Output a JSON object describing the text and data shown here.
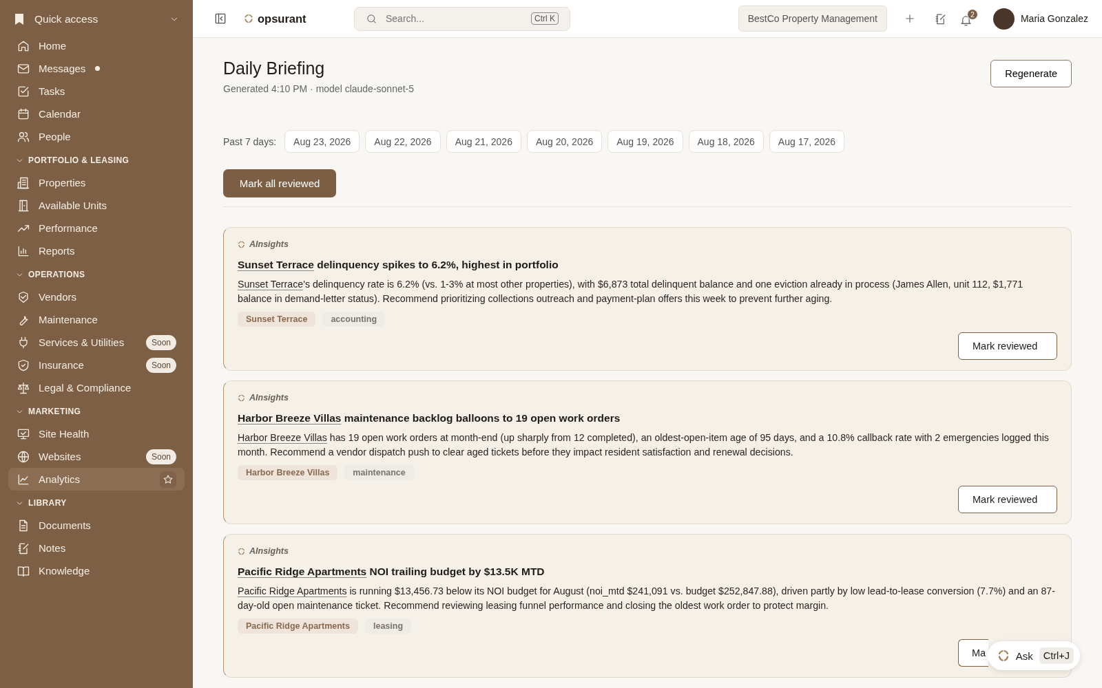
{
  "sidebar": {
    "header": {
      "label": "Quick access",
      "expanded": true
    },
    "items": [
      {
        "label": "Home",
        "selected": false,
        "unread": false
      },
      {
        "label": "Messages",
        "selected": false,
        "unread": true
      },
      {
        "label": "Tasks",
        "selected": false,
        "unread": false
      },
      {
        "label": "Calendar",
        "selected": false,
        "unread": false
      },
      {
        "label": "People",
        "selected": false,
        "unread": false
      }
    ],
    "sections": [
      {
        "title": "PORTFOLIO & LEASING",
        "expanded": true,
        "items": [
          {
            "label": "Properties",
            "selected": false
          },
          {
            "label": "Available Units",
            "selected": false
          },
          {
            "label": "Performance",
            "selected": false
          },
          {
            "label": "Reports",
            "selected": false
          }
        ]
      },
      {
        "title": "OPERATIONS",
        "expanded": true,
        "items": [
          {
            "label": "Vendors",
            "selected": false
          },
          {
            "label": "Maintenance",
            "selected": false
          },
          {
            "label": "Services & Utilities",
            "selected": false,
            "badge": "Soon"
          },
          {
            "label": "Insurance",
            "selected": false,
            "badge": "Soon"
          },
          {
            "label": "Legal & Compliance",
            "selected": false
          }
        ]
      },
      {
        "title": "MARKETING",
        "expanded": true,
        "items": [
          {
            "label": "Site Health",
            "selected": false
          },
          {
            "label": "Websites",
            "selected": false,
            "badge": "Soon"
          },
          {
            "label": "Analytics",
            "selected": true
          }
        ]
      },
      {
        "title": "LIBRARY",
        "expanded": true,
        "items": [
          {
            "label": "Documents",
            "selected": false
          },
          {
            "label": "Notes",
            "selected": false
          },
          {
            "label": "Knowledge",
            "selected": false
          }
        ]
      }
    ]
  },
  "topbar": {
    "logo": "opsurant",
    "search": {
      "placeholder": "Search...",
      "shortcut": "Ctrl K"
    },
    "organization": "BestCo Property Management",
    "notifications": "2",
    "user": "Maria Gonzalez"
  },
  "briefing": {
    "title": "Daily Briefing",
    "subtitle": "Generated 4:10 PM · model claude-sonnet-5",
    "regenerate": "Regenerate",
    "dates_label": "Past 7 days:",
    "dates": [
      "Aug 23, 2026",
      "Aug 22, 2026",
      "Aug 21, 2026",
      "Aug 20, 2026",
      "Aug 19, 2026",
      "Aug 18, 2026",
      "Aug 17, 2026"
    ],
    "mark_all": "Mark all reviewed",
    "cards": [
      {
        "source": "AInsights",
        "title": {
          "link": "Sunset Terrace",
          "text": " delinquency spikes to 6.2%, highest in portfolio"
        },
        "body": {
          "link": "Sunset Terrace",
          "text": "'s delinquency rate is 6.2% (vs. 1-3% at most other properties), with $6,873 total delinquent balance and one eviction already in process (James Allen, unit 112, $1,771 balance in demand-letter status). Recommend prioritizing collections outreach and payment-plan offers this week to prevent further aging."
        },
        "tags": [
          {
            "label": "Sunset Terrace",
            "kind": "property"
          },
          {
            "label": "accounting",
            "kind": "category"
          }
        ],
        "button": "Mark reviewed",
        "button_covered": false
      },
      {
        "source": "AInsights",
        "title": {
          "link": "Harbor Breeze Villas",
          "text": " maintenance backlog balloons to 19 open work orders"
        },
        "body": {
          "link": "Harbor Breeze Villas",
          "text": " has 19 open work orders at month-end (up sharply from 12 completed), an oldest-open-item age of 95 days, and a 10.8% callback rate with 2 emergencies logged this month. Recommend a vendor dispatch push to clear aged tickets before they impact resident satisfaction and renewal decisions."
        },
        "tags": [
          {
            "label": "Harbor Breeze Villas",
            "kind": "property"
          },
          {
            "label": "maintenance",
            "kind": "category"
          }
        ],
        "button": "Mark reviewed",
        "button_covered": false
      },
      {
        "source": "AInsights",
        "title": {
          "link": "Pacific Ridge Apartments",
          "text": " NOI trailing budget by $13.5K MTD"
        },
        "body": {
          "link": "Pacific Ridge Apartments",
          "text": " is running $13,456.73 below its NOI budget for August (noi_mtd $241,091 vs. budget $252,847.88), driven partly by low lead-to-lease conversion (7.7%) and an 87-day-old open maintenance ticket. Recommend reviewing leasing funnel performance and closing the oldest work order to protect margin."
        },
        "tags": [
          {
            "label": "Pacific Ridge Apartments",
            "kind": "property"
          },
          {
            "label": "leasing",
            "kind": "category"
          }
        ],
        "button": "Ma",
        "button_covered": true
      }
    ]
  },
  "ask": {
    "label": "Ask",
    "shortcut": "Ctrl+J"
  }
}
